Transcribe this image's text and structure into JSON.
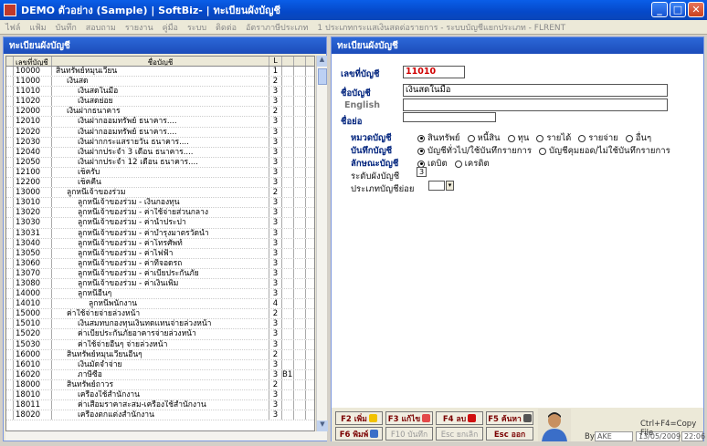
{
  "window": {
    "title": "DEMO  ตัวอย่าง (Sample)   |   SoftBiz-   |   ทะเบียนผังบัญชี",
    "min": "_",
    "max": "□",
    "close": "✕"
  },
  "menu": [
    "ไฟล์",
    "แฟ้ม",
    "บันทึก",
    "สอบถาม",
    "รายงาน",
    "คู่มือ",
    "ระบบ",
    "ติดต่อ",
    "อัตราภาษีประเภท",
    "1 ประเภทกระแสเงินสดต่อรายการ - ระบบบัญชีแยกประเภท - FLRENT"
  ],
  "left": {
    "header": "ทะเบียนผังบัญชี",
    "columns": {
      "code": "เลขที่บัญชี",
      "name": "ชื่อบัญชี",
      "level": "L"
    },
    "rows": [
      {
        "code": "10000",
        "name": "สินทรัพย์หมุนเวียน",
        "level": "1",
        "extra": "",
        "indent": 0
      },
      {
        "code": "11000",
        "name": "เงินสด",
        "level": "2",
        "extra": "",
        "indent": 1
      },
      {
        "code": "11010",
        "name": "เงินสดในมือ",
        "level": "3",
        "extra": "",
        "indent": 2
      },
      {
        "code": "11020",
        "name": "เงินสดย่อย",
        "level": "3",
        "extra": "",
        "indent": 2
      },
      {
        "code": "12000",
        "name": "เงินฝากธนาคาร",
        "level": "2",
        "extra": "",
        "indent": 1
      },
      {
        "code": "12010",
        "name": "เงินฝากออมทรัพย์ ธนาคาร....",
        "level": "3",
        "extra": "",
        "indent": 2
      },
      {
        "code": "12020",
        "name": "เงินฝากออมทรัพย์ ธนาคาร....",
        "level": "3",
        "extra": "",
        "indent": 2
      },
      {
        "code": "12030",
        "name": "เงินฝากกระแสรายวัน ธนาคาร....",
        "level": "3",
        "extra": "",
        "indent": 2
      },
      {
        "code": "12040",
        "name": "เงินฝากประจำ 3 เดือน ธนาคาร....",
        "level": "3",
        "extra": "",
        "indent": 2
      },
      {
        "code": "12050",
        "name": "เงินฝากประจำ 12 เดือน ธนาคาร....",
        "level": "3",
        "extra": "",
        "indent": 2
      },
      {
        "code": "12100",
        "name": "เช็ครับ",
        "level": "3",
        "extra": "",
        "indent": 2
      },
      {
        "code": "12200",
        "name": "เช็คคืน",
        "level": "3",
        "extra": "",
        "indent": 2
      },
      {
        "code": "13000",
        "name": "ลูกหนี้เจ้าของร่วม",
        "level": "2",
        "extra": "",
        "indent": 1
      },
      {
        "code": "13010",
        "name": "ลูกหนี้เจ้าของร่วม - เงินกองทุน",
        "level": "3",
        "extra": "",
        "indent": 2
      },
      {
        "code": "13020",
        "name": "ลูกหนี้เจ้าของร่วม - ค่าใช้จ่ายส่วนกลาง",
        "level": "3",
        "extra": "",
        "indent": 2
      },
      {
        "code": "13030",
        "name": "ลูกหนี้เจ้าของร่วม - ค่าน้ำประปา",
        "level": "3",
        "extra": "",
        "indent": 2
      },
      {
        "code": "13031",
        "name": "ลูกหนี้เจ้าของร่วม - ค่าบำรุงมาตรวัดน้ำ",
        "level": "3",
        "extra": "",
        "indent": 2
      },
      {
        "code": "13040",
        "name": "ลูกหนี้เจ้าของร่วม - ค่าโทรศัพท์",
        "level": "3",
        "extra": "",
        "indent": 2
      },
      {
        "code": "13050",
        "name": "ลูกหนี้เจ้าของร่วม - ค่าไฟฟ้า",
        "level": "3",
        "extra": "",
        "indent": 2
      },
      {
        "code": "13060",
        "name": "ลูกหนี้เจ้าของร่วม - ค่าที่จอดรถ",
        "level": "3",
        "extra": "",
        "indent": 2
      },
      {
        "code": "13070",
        "name": "ลูกหนี้เจ้าของร่วม - ค่าเบี้ยประกันภัย",
        "level": "3",
        "extra": "",
        "indent": 2
      },
      {
        "code": "13080",
        "name": "ลูกหนี้เจ้าของร่วม - ค่าเงินเพิ่ม",
        "level": "3",
        "extra": "",
        "indent": 2
      },
      {
        "code": "14000",
        "name": "ลูกหนี้อื่นๆ",
        "level": "3",
        "extra": "",
        "indent": 2
      },
      {
        "code": "14010",
        "name": "ลูกหนี้พนักงาน",
        "level": "4",
        "extra": "",
        "indent": 3
      },
      {
        "code": "15000",
        "name": "ค่าใช้จ่ายจ่ายล่วงหน้า",
        "level": "2",
        "extra": "",
        "indent": 1
      },
      {
        "code": "15010",
        "name": "เงินสมทบกองทุนเงินทดแทนจ่ายล่วงหน้า",
        "level": "3",
        "extra": "",
        "indent": 2
      },
      {
        "code": "15020",
        "name": "ค่าเบี้ยประกันภัยอาคารจ่ายล่วงหน้า",
        "level": "3",
        "extra": "",
        "indent": 2
      },
      {
        "code": "15030",
        "name": "ค่าใช้จ่ายอื่นๆ จ่ายล่วงหน้า",
        "level": "3",
        "extra": "",
        "indent": 2
      },
      {
        "code": "16000",
        "name": "สินทรัพย์หมุนเวียนอื่นๆ",
        "level": "2",
        "extra": "",
        "indent": 1
      },
      {
        "code": "16010",
        "name": "เงินมัดจำจ่าย",
        "level": "3",
        "extra": "",
        "indent": 2
      },
      {
        "code": "16020",
        "name": "ภาษีซื้อ",
        "level": "3",
        "extra": "B1",
        "indent": 2
      },
      {
        "code": "18000",
        "name": "สินทรัพย์ถาวร",
        "level": "2",
        "extra": "",
        "indent": 1
      },
      {
        "code": "18010",
        "name": "เครื่องใช้สำนักงาน",
        "level": "3",
        "extra": "",
        "indent": 2
      },
      {
        "code": "18011",
        "name": "ค่าเสื่อมราคาสะสม-เครื่องใช้สำนักงาน",
        "level": "3",
        "extra": "",
        "indent": 2
      },
      {
        "code": "18020",
        "name": "เครื่องตกแต่งสำนักงาน",
        "level": "3",
        "extra": "",
        "indent": 2
      }
    ]
  },
  "right": {
    "header": "ทะเบียนผังบัญชี",
    "labels": {
      "account_no": "เลขที่บัญชี",
      "account_name": "ชื่อบัญชี",
      "english": "English",
      "short_name": "ชื่อย่อ",
      "category": "หมวดบัญชี",
      "posting": "บันทึกบัญชี",
      "nature": "ลักษณะบัญชี",
      "level": "ระดับผังบัญชี",
      "subtype": "ประเภทบัญชีย่อย"
    },
    "values": {
      "account_no": "11010",
      "account_name": "เงินสดในมือ",
      "english": "",
      "short_name": "",
      "level": "3"
    },
    "category_options": [
      "สินทรัพย์",
      "หนี้สิน",
      "ทุน",
      "รายได้",
      "รายจ่าย",
      "อื่นๆ"
    ],
    "category_selected": 0,
    "posting_options": [
      "บัญชีทั่วไป/ใช้บันทึกรายการ",
      "บัญชีคุมยอด/ไม่ใช้บันทึกรายการ"
    ],
    "posting_selected": 0,
    "nature_options": [
      "เดบิต",
      "เครดิต"
    ],
    "nature_selected": 0
  },
  "footer": {
    "buttons": [
      {
        "label": "F2 เพิ่ม",
        "icon": "add-icon",
        "color": "#f2c200",
        "enabled": true
      },
      {
        "label": "F3 แก้ไข",
        "icon": "edit-icon",
        "color": "#e34a4a",
        "enabled": true
      },
      {
        "label": "F4 ลบ",
        "icon": "delete-icon",
        "color": "#d01010",
        "enabled": true
      },
      {
        "label": "F5 ค้นหา",
        "icon": "search-icon",
        "color": "#555555",
        "enabled": true
      },
      {
        "label": "F6 พิมพ์",
        "icon": "print-icon",
        "color": "#3a6ec8",
        "enabled": true
      },
      {
        "label": "F10 บันทึก",
        "icon": "save-icon",
        "color": "",
        "enabled": false
      },
      {
        "label": "Esc ยกเลิก",
        "icon": "cancel-icon",
        "color": "",
        "enabled": false
      },
      {
        "label": "Esc ออก",
        "icon": "exit-icon",
        "color": "",
        "enabled": true
      }
    ],
    "shortcut": "Ctrl+F4=Copy File",
    "by_label": "By",
    "user": "AKE",
    "date": "13/05/2009",
    "time": "22:06"
  }
}
